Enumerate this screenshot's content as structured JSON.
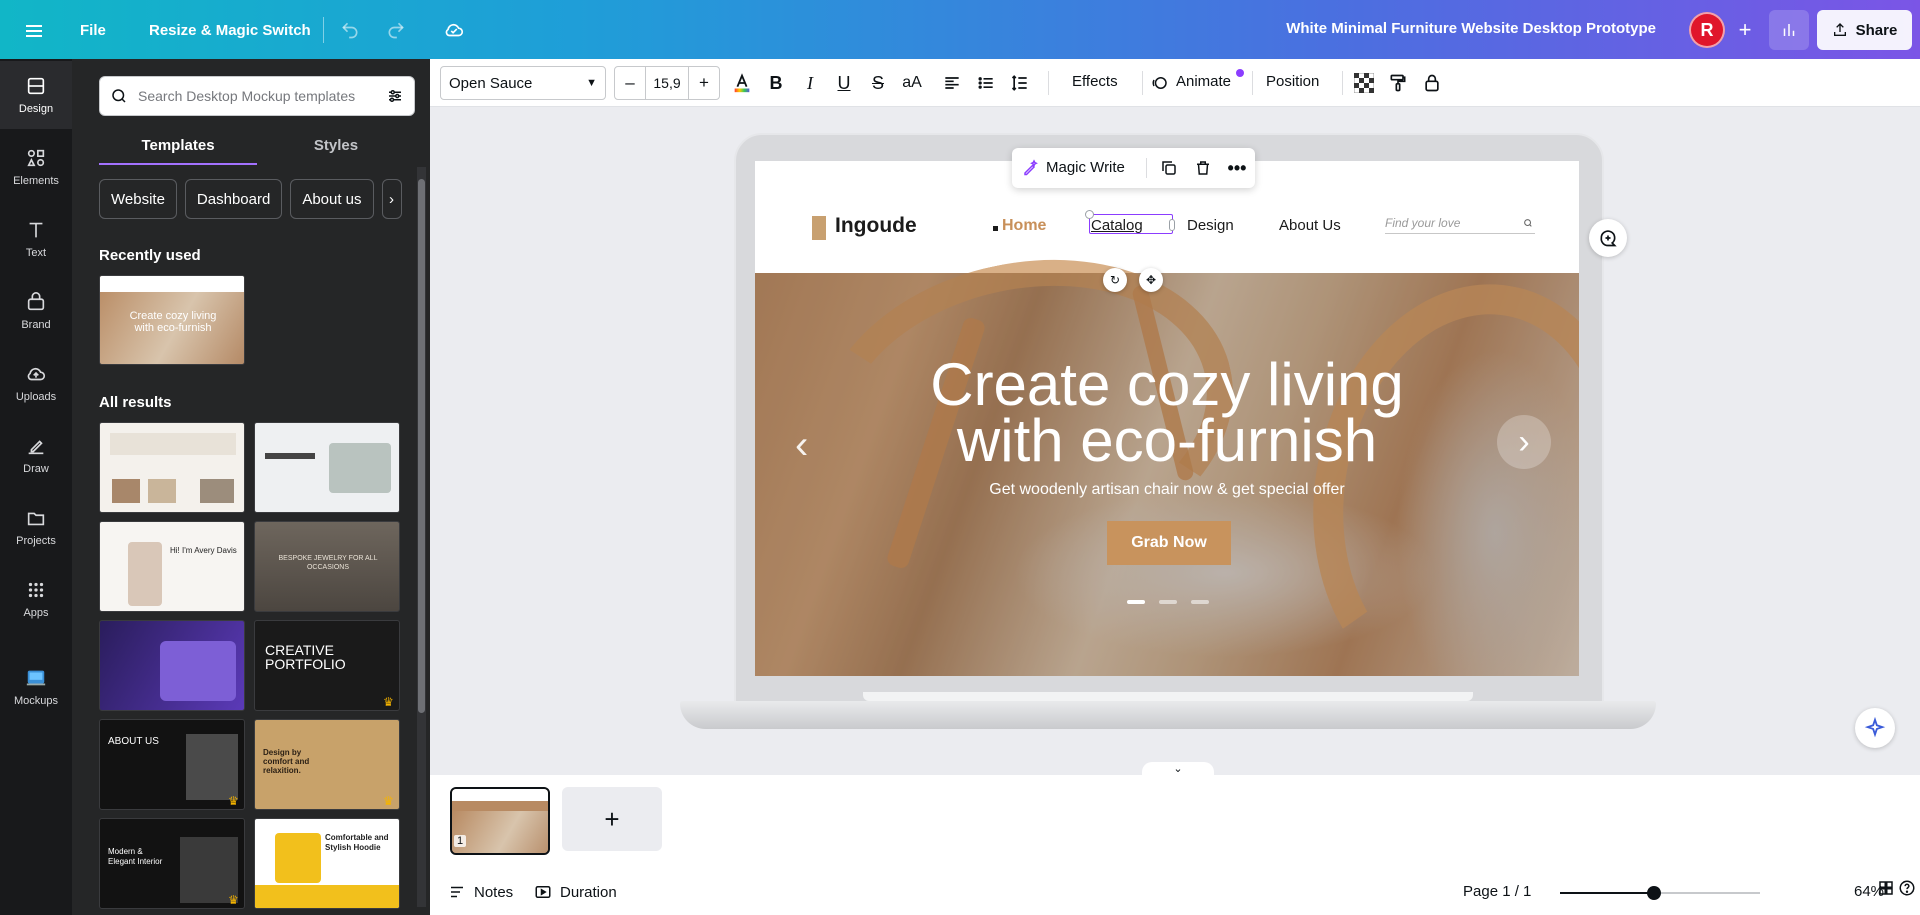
{
  "topbar": {
    "file_label": "File",
    "resize_label": "Resize & Magic Switch",
    "doc_title": "White Minimal Furniture Website Desktop Prototype",
    "avatar_initial": "R",
    "share_label": "Share"
  },
  "rail": {
    "items": [
      {
        "label": "Design",
        "icon": "design-icon"
      },
      {
        "label": "Elements",
        "icon": "elements-icon"
      },
      {
        "label": "Text",
        "icon": "text-icon"
      },
      {
        "label": "Brand",
        "icon": "brand-icon"
      },
      {
        "label": "Uploads",
        "icon": "uploads-icon"
      },
      {
        "label": "Draw",
        "icon": "draw-icon"
      },
      {
        "label": "Projects",
        "icon": "projects-icon"
      },
      {
        "label": "Apps",
        "icon": "apps-icon"
      },
      {
        "label": "Mockups",
        "icon": "mockups-icon"
      }
    ]
  },
  "panel": {
    "search_placeholder": "Search Desktop Mockup templates",
    "tabs": [
      "Templates",
      "Styles"
    ],
    "chips": [
      "Website",
      "Dashboard",
      "About us"
    ],
    "recently_used_title": "Recently used",
    "recent_thumb_text": "Create cozy living with eco-furnish",
    "all_results_title": "All results",
    "results": [
      {
        "text": "",
        "theme": "light"
      },
      {
        "text": "",
        "theme": "light"
      },
      {
        "text": "Hi! I'm Avery Davis",
        "theme": "light"
      },
      {
        "text": "BESPOKE JEWELRY FOR ALL OCCASIONS",
        "theme": "dark-gray"
      },
      {
        "text": "",
        "theme": "purple"
      },
      {
        "text": "CREATIVE PORTFOLIO",
        "theme": "black"
      },
      {
        "text": "ABOUT US",
        "theme": "black"
      },
      {
        "text": "Design by comfort and relaxition.",
        "theme": "tan"
      },
      {
        "text": "Modern & Elegant Interior",
        "theme": "black"
      },
      {
        "text": "Comfortable and Stylish Hoodie",
        "theme": "yellow"
      }
    ]
  },
  "toolbar": {
    "font_name": "Open Sauce",
    "font_size": "15,9",
    "effects_label": "Effects",
    "animate_label": "Animate",
    "position_label": "Position"
  },
  "context": {
    "magic_write_label": "Magic Write"
  },
  "site": {
    "logo": "Ingoude",
    "nav": [
      "Home",
      "Catalog",
      "Design",
      "About Us"
    ],
    "search_placeholder": "Find your love",
    "hero_title_line1": "Create cozy living",
    "hero_title_line2": "with eco-furnish",
    "hero_subtitle": "Get woodenly artisan chair now & get special offer",
    "cta_label": "Grab Now",
    "slides": 3,
    "active_slide": 1
  },
  "pages": {
    "current_page_number": "1",
    "add_label": "+"
  },
  "footer": {
    "notes_label": "Notes",
    "duration_label": "Duration",
    "page_indicator": "Page 1 / 1",
    "zoom_label": "64%",
    "zoom_value": 64
  },
  "colors": {
    "accent_purple": "#8b3dff",
    "brand_tan": "#c8935d",
    "rail_bg": "#18191b",
    "panel_bg": "#252627"
  }
}
